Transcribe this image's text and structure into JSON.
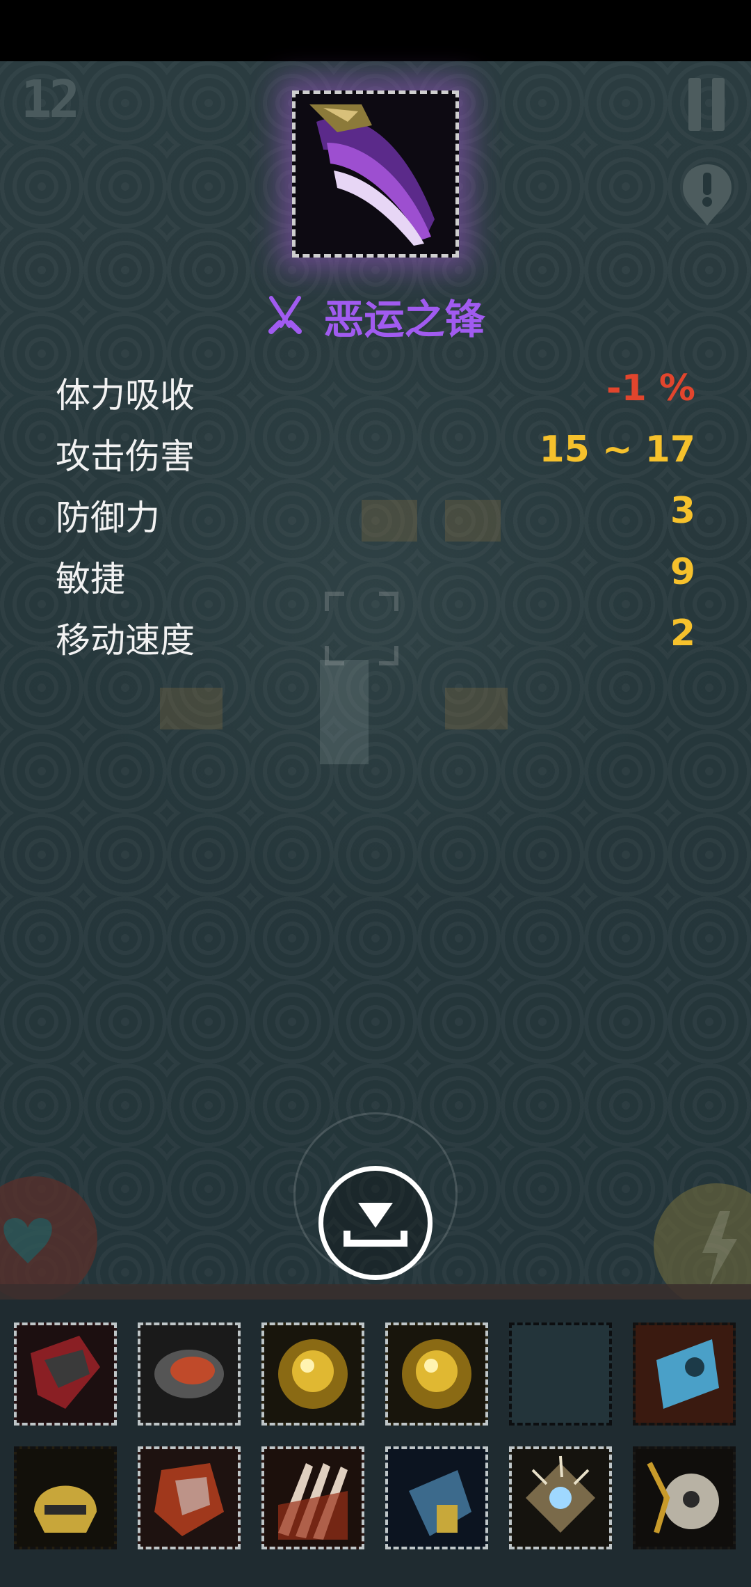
{
  "hud": {
    "level_number": "12",
    "pause_icon": "pause-icon",
    "alert_icon": "alert-icon"
  },
  "item": {
    "name": "恶运之锋",
    "type_icon": "crossed-swords-icon",
    "name_color": "#a15bf0",
    "glow_color": "#aa5adc"
  },
  "stats": [
    {
      "label": "体力吸收",
      "value": "-1 %",
      "color": "#e2452d"
    },
    {
      "label": "攻击伤害",
      "value": "15 ~ 17",
      "color": "#f6c12c"
    },
    {
      "label": "防御力",
      "value": "3",
      "color": "#f6c12c"
    },
    {
      "label": "敏捷",
      "value": "9",
      "color": "#f6c12c"
    },
    {
      "label": "移动速度",
      "value": "2",
      "color": "#f6c12c"
    }
  ],
  "actions": {
    "equip_icon": "equip-download-icon",
    "heal_icon": "heart-icon",
    "skill_icon": "lightning-icon"
  },
  "inventory": {
    "slots": [
      {
        "icon": "red-gauntlet-icon"
      },
      {
        "icon": "bracer-icon"
      },
      {
        "icon": "gold-amulet-icon"
      },
      {
        "icon": "gold-amulet-icon"
      },
      {
        "icon": "empty-slot"
      },
      {
        "icon": "blue-scroll-icon"
      },
      {
        "icon": "gold-helmet-icon"
      },
      {
        "icon": "red-gauntlet-icon"
      },
      {
        "icon": "claw-weapon-icon"
      },
      {
        "icon": "blue-glove-icon"
      },
      {
        "icon": "spiked-armor-icon"
      },
      {
        "icon": "skull-necklace-icon"
      }
    ]
  }
}
